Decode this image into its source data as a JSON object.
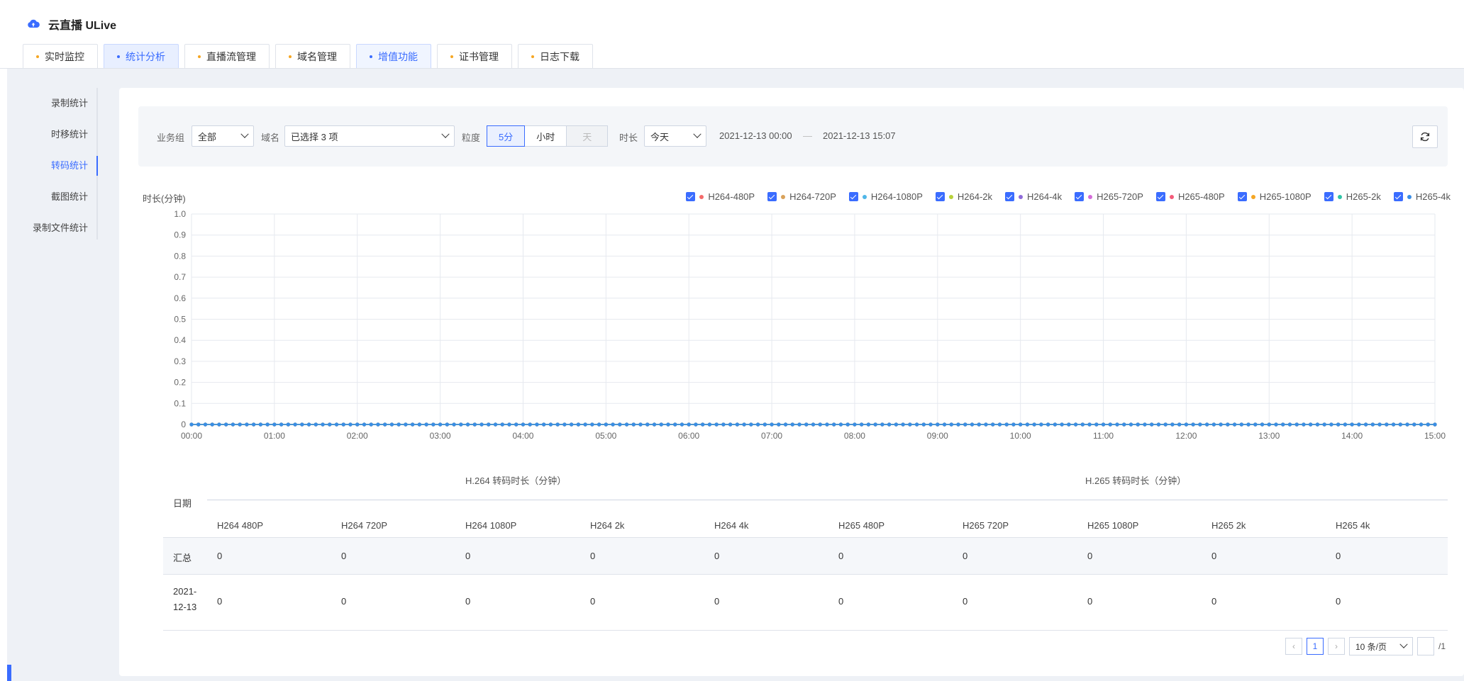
{
  "app": {
    "title": "云直播 ULive",
    "logo_icon": "cloud-upload-icon"
  },
  "tabs": [
    {
      "label": "实时监控",
      "state": "normal"
    },
    {
      "label": "统计分析",
      "state": "active"
    },
    {
      "label": "直播流管理",
      "state": "normal"
    },
    {
      "label": "域名管理",
      "state": "normal"
    },
    {
      "label": "增值功能",
      "state": "highlight"
    },
    {
      "label": "证书管理",
      "state": "normal"
    },
    {
      "label": "日志下载",
      "state": "normal"
    }
  ],
  "sidebar": {
    "items": [
      {
        "label": "录制统计"
      },
      {
        "label": "时移统计"
      },
      {
        "label": "转码统计",
        "active": true
      },
      {
        "label": "截图统计"
      },
      {
        "label": "录制文件统计"
      }
    ]
  },
  "filters": {
    "business_group_label": "业务组",
    "business_group_value": "全部",
    "domain_label": "域名",
    "domain_value": "已选择 3 项",
    "granularity_label": "粒度",
    "granularity_options": [
      "5分",
      "小时",
      "天"
    ],
    "granularity_selected": "5分",
    "duration_label": "时长",
    "duration_value": "今天",
    "range_start": "2021-12-13 00:00",
    "range_sep": "—",
    "range_end": "2021-12-13 15:07",
    "refresh_icon": "refresh-icon"
  },
  "chart_data": {
    "type": "line",
    "ylabel": "时长(分钟)",
    "ylim": [
      0,
      1.0
    ],
    "y_ticks": [
      "1.0",
      "0.9",
      "0.8",
      "0.7",
      "0.6",
      "0.5",
      "0.4",
      "0.3",
      "0.2",
      "0.1",
      "0"
    ],
    "x_ticks": [
      "00:00",
      "01:00",
      "02:00",
      "03:00",
      "04:00",
      "05:00",
      "06:00",
      "07:00",
      "08:00",
      "09:00",
      "10:00",
      "11:00",
      "12:00",
      "13:00",
      "14:00",
      "15:00"
    ],
    "x_interval_minutes": 5,
    "grid": true,
    "legend_position": "top-right",
    "series": [
      {
        "name": "H264-480P",
        "color": "#f46b6b",
        "value": 0
      },
      {
        "name": "H264-720P",
        "color": "#d9a25a",
        "value": 0
      },
      {
        "name": "H264-1080P",
        "color": "#4fb6e8",
        "value": 0
      },
      {
        "name": "H264-2k",
        "color": "#b8d13a",
        "value": 0
      },
      {
        "name": "H264-4k",
        "color": "#8f6bd9",
        "value": 0
      },
      {
        "name": "H265-720P",
        "color": "#d56bd9",
        "value": 0
      },
      {
        "name": "H265-480P",
        "color": "#f45b7a",
        "value": 0
      },
      {
        "name": "H265-1080P",
        "color": "#f5a623",
        "value": 0
      },
      {
        "name": "H265-2k",
        "color": "#2fc4a6",
        "value": 0
      },
      {
        "name": "H265-4k",
        "color": "#3a8ee6",
        "value": 0
      }
    ]
  },
  "table": {
    "group_h264": "H.264 转码时长（分钟）",
    "group_h265": "H.265 转码时长（分钟）",
    "date_header": "日期",
    "columns": [
      "H264 480P",
      "H264 720P",
      "H264 1080P",
      "H264 2k",
      "H264 4k",
      "H265 480P",
      "H265 720P",
      "H265 1080P",
      "H265 2k",
      "H265 4k"
    ],
    "rows": [
      {
        "date": "汇总",
        "values": [
          "0",
          "0",
          "0",
          "0",
          "0",
          "0",
          "0",
          "0",
          "0",
          "0"
        ]
      },
      {
        "date_line1": "2021-",
        "date_line2": "12-13",
        "values": [
          "0",
          "0",
          "0",
          "0",
          "0",
          "0",
          "0",
          "0",
          "0",
          "0"
        ]
      }
    ]
  },
  "pagination": {
    "prev": "‹",
    "current_page": "1",
    "next": "›",
    "page_size": "10 条/页",
    "total_pages": "/1"
  }
}
